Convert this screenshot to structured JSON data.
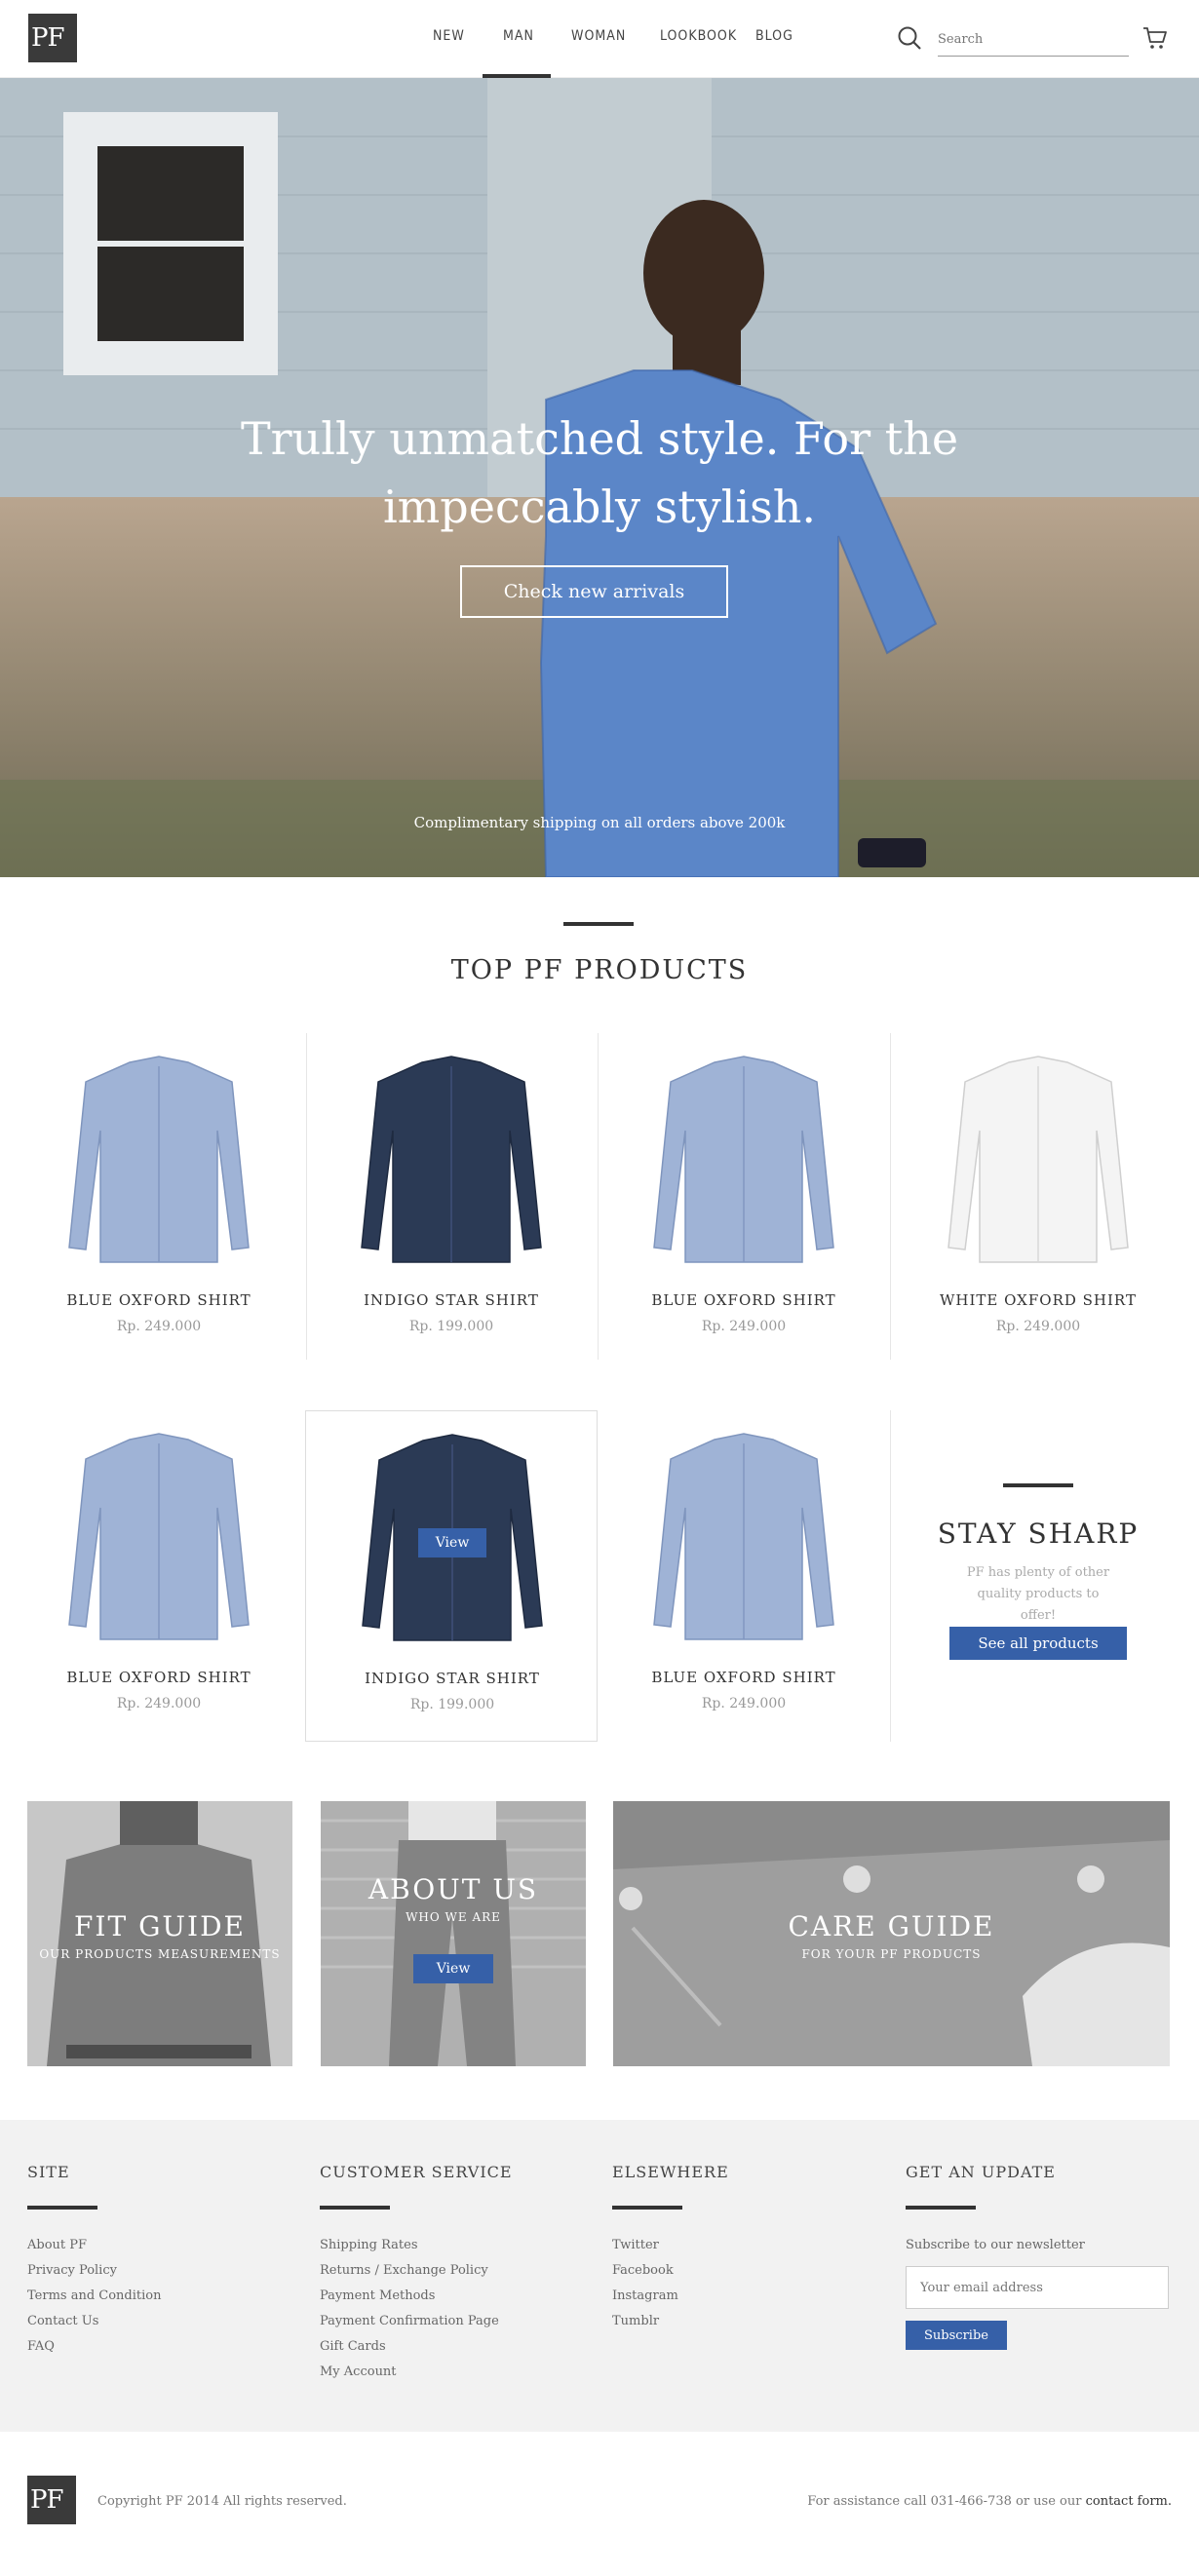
{
  "header": {
    "logo": "PF",
    "nav": [
      "NEW",
      "MAN",
      "WOMAN",
      "LOOKBOOK",
      "BLOG"
    ],
    "active_nav": "MAN",
    "search_placeholder": "Search",
    "search_icon": "search-icon",
    "cart_icon": "cart-icon"
  },
  "hero": {
    "title_line1": "Trully unmatched style. For the",
    "title_line2": "impeccably stylish.",
    "cta": "Check new arrivals",
    "note": "Complimentary shipping on all orders above 200k"
  },
  "products_section": {
    "title": "TOP PF PRODUCTS",
    "row1": [
      {
        "name": "BLUE OXFORD SHIRT",
        "price": "Rp. 249.000",
        "color": "#9fb3d6"
      },
      {
        "name": "INDIGO STAR SHIRT",
        "price": "Rp. 199.000",
        "color": "#2b3a55"
      },
      {
        "name": "BLUE OXFORD SHIRT",
        "price": "Rp. 249.000",
        "color": "#9fb3d6"
      },
      {
        "name": "WHITE OXFORD SHIRT",
        "price": "Rp. 249.000",
        "color": "#f4f4f4"
      }
    ],
    "row2": [
      {
        "name": "BLUE OXFORD SHIRT",
        "price": "Rp. 249.000",
        "color": "#9fb3d6"
      },
      {
        "name": "INDIGO STAR SHIRT",
        "price": "Rp. 199.000",
        "color": "#2b3a55"
      },
      {
        "name": "BLUE OXFORD SHIRT",
        "price": "Rp. 249.000",
        "color": "#9fb3d6"
      }
    ],
    "view_label": "View"
  },
  "stay_sharp": {
    "title": "STAY SHARP",
    "desc": "PF has plenty of other quality products to offer!",
    "button": "See all products"
  },
  "tiles": {
    "fit": {
      "title": "FIT GUIDE",
      "sub": "OUR PRODUCTS MEASUREMENTS"
    },
    "about": {
      "title": "ABOUT US",
      "sub": "WHO WE ARE",
      "button": "View"
    },
    "care": {
      "title": "CARE GUIDE",
      "sub": "FOR YOUR PF PRODUCTS"
    }
  },
  "footer": {
    "site": {
      "heading": "SITE",
      "links": [
        "About PF",
        "Privacy Policy",
        "Terms and Condition",
        "Contact Us",
        "FAQ"
      ]
    },
    "service": {
      "heading": "CUSTOMER SERVICE",
      "links": [
        "Shipping Rates",
        "Returns / Exchange Policy",
        "Payment Methods",
        "Payment Confirmation Page",
        "Gift Cards",
        "My Account"
      ]
    },
    "elsewhere": {
      "heading": "ELSEWHERE",
      "links": [
        "Twitter",
        "Facebook",
        "Instagram",
        "Tumblr"
      ]
    },
    "update": {
      "heading": "GET AN UPDATE",
      "text": "Subscribe to our newsletter",
      "placeholder": "Your email address",
      "button": "Subscribe"
    }
  },
  "bottom": {
    "logo": "PF",
    "copyright": "Copyright PF 2014 All rights reserved.",
    "assist_prefix": "For assistance call 031-466-738 or use our",
    "assist_link": "contact form."
  },
  "colors": {
    "accent": "#3660a8",
    "dark": "#333333",
    "footer_bg": "#f2f2f2"
  }
}
